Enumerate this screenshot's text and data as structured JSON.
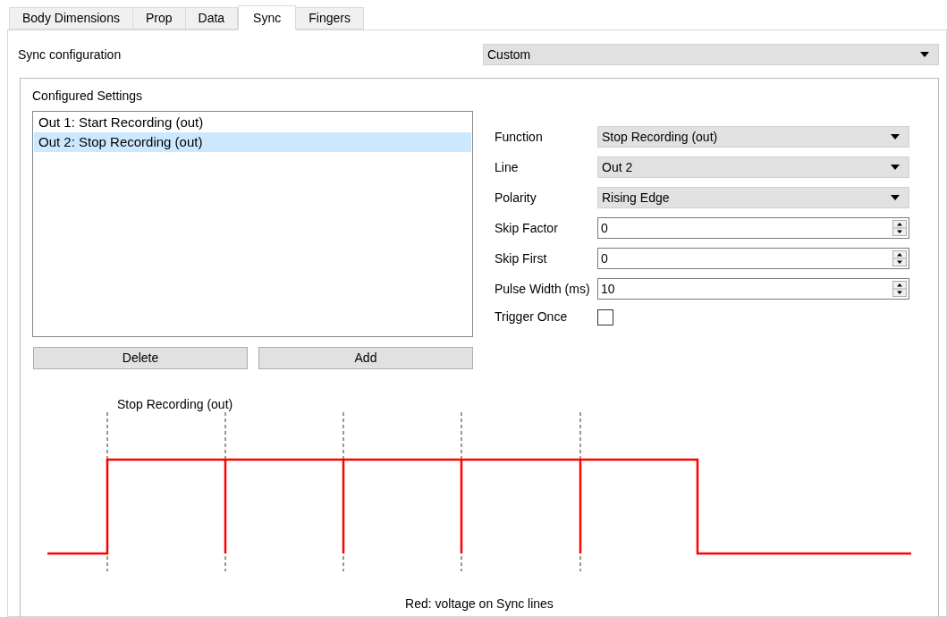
{
  "tabs": [
    {
      "label": "Body Dimensions",
      "selected": false
    },
    {
      "label": "Prop",
      "selected": false
    },
    {
      "label": "Data",
      "selected": false
    },
    {
      "label": "Sync",
      "selected": true
    },
    {
      "label": "Fingers",
      "selected": false
    }
  ],
  "sync_configuration": {
    "label": "Sync configuration",
    "value": "Custom"
  },
  "configured_settings": {
    "title": "Configured Settings",
    "items": [
      {
        "label": "Out 1: Start Recording (out)",
        "selected": false
      },
      {
        "label": "Out 2: Stop Recording (out)",
        "selected": true
      }
    ],
    "buttons": [
      "Delete",
      "Add"
    ]
  },
  "fields": [
    {
      "kind": "dropdown",
      "label": "Function",
      "value": "Stop Recording (out)"
    },
    {
      "kind": "dropdown",
      "label": "Line",
      "value": "Out 2"
    },
    {
      "kind": "dropdown",
      "label": "Polarity",
      "value": "Rising Edge"
    },
    {
      "kind": "spin",
      "label": "Skip Factor",
      "value": "0"
    },
    {
      "kind": "spin",
      "label": "Skip First",
      "value": "0"
    },
    {
      "kind": "spin",
      "label": "Pulse Width (ms)",
      "value": "10"
    },
    {
      "kind": "checkbox",
      "label": "Trigger Once",
      "checked": false
    }
  ],
  "diagram": {
    "title": "Stop Recording (out)",
    "caption": "Red: voltage on Sync lines"
  }
}
